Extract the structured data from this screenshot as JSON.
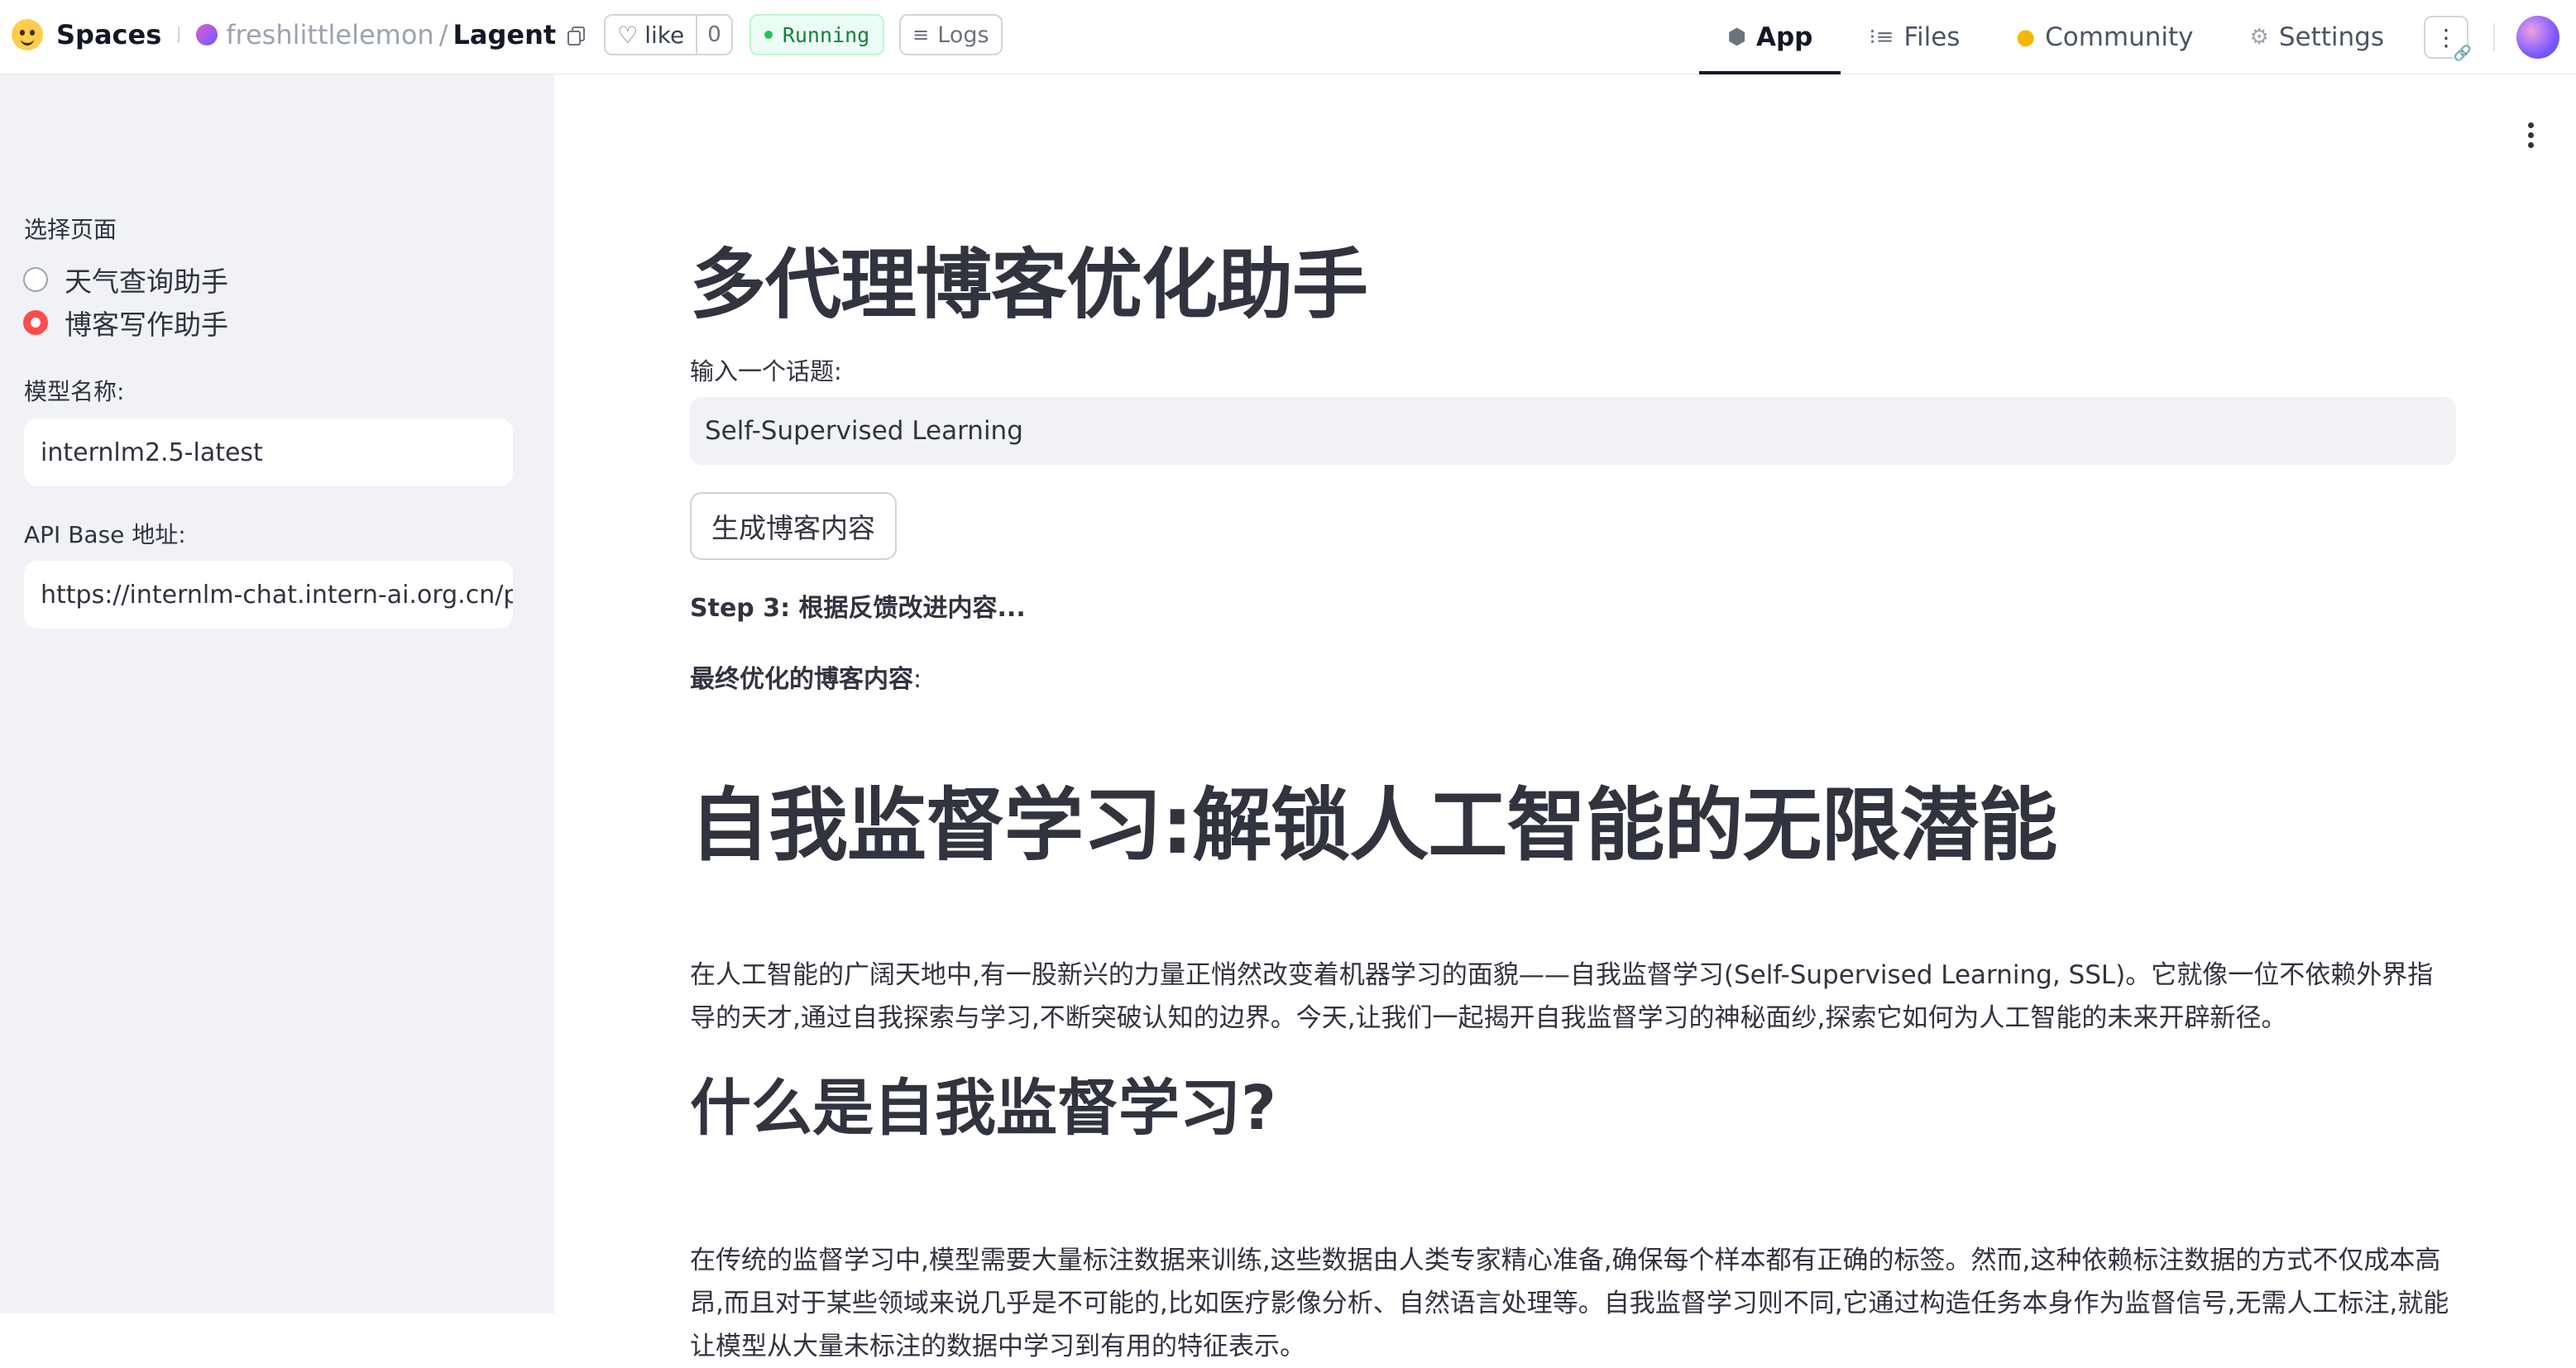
{
  "header": {
    "brand": "Spaces",
    "owner": "freshlittlelemon",
    "separator": "/",
    "repo": "Lagent",
    "like_label": "like",
    "like_count": "0",
    "status": "Running",
    "logs_label": "Logs",
    "tabs": [
      {
        "label": "App",
        "icon": "cube-icon",
        "active": true
      },
      {
        "label": "Files",
        "icon": "files-icon",
        "active": false
      },
      {
        "label": "Community",
        "icon": "community-icon",
        "active": false
      },
      {
        "label": "Settings",
        "icon": "gear-icon",
        "active": false
      }
    ],
    "status_color": "#22c55e"
  },
  "sidebar": {
    "page_select_label": "选择页面",
    "pages": [
      {
        "label": "天气查询助手",
        "selected": false
      },
      {
        "label": "博客写作助手",
        "selected": true
      }
    ],
    "model_label": "模型名称:",
    "model_value": "internlm2.5-latest",
    "api_label": "API Base 地址:",
    "api_value": "https://internlm-chat.intern-ai.org.cn/pu",
    "accent_color": "#ff4b4b"
  },
  "main": {
    "title": "多代理博客优化助手",
    "topic_label": "输入一个话题:",
    "topic_value": "Self-Supervised Learning",
    "generate_button": "生成博客内容",
    "step_text": "Step 3: 根据反馈改进内容...",
    "final_label": "最终优化的博客内容",
    "final_colon": ":",
    "article": {
      "h1": "自我监督学习:解锁人工智能的无限潜能",
      "intro": "在人工智能的广阔天地中,有一股新兴的力量正悄然改变着机器学习的面貌——自我监督学习(Self-Supervised Learning, SSL)。它就像一位不依赖外界指导的天才,通过自我探索与学习,不断突破认知的边界。今天,让我们一起揭开自我监督学习的神秘面纱,探索它如何为人工智能的未来开辟新径。",
      "h2": "什么是自我监督学习?",
      "para2": "在传统的监督学习中,模型需要大量标注数据来训练,这些数据由人类专家精心准备,确保每个样本都有正确的标签。然而,这种依赖标注数据的方式不仅成本高昂,而且对于某些领域来说几乎是不可能的,比如医疗影像分析、自然语言处理等。自我监督学习则不同,它通过构造任务本身作为监督信号,无需人工标注,就能让模型从大量未标注的数据中学习到有用的特征表示。"
    }
  }
}
